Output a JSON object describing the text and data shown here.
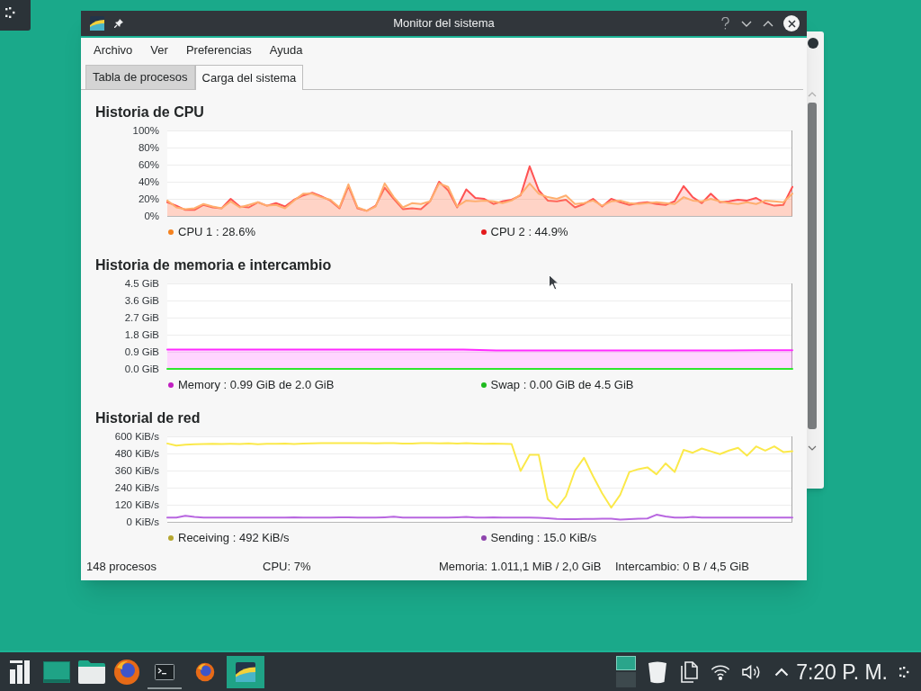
{
  "window": {
    "title": "Monitor del sistema"
  },
  "menu": [
    "Archivo",
    "Ver",
    "Preferencias",
    "Ayuda"
  ],
  "tabs": [
    {
      "label": "Tabla de procesos",
      "selected": false
    },
    {
      "label": "Carga del sistema",
      "selected": true
    }
  ],
  "sections": [
    {
      "title": "Historia de CPU",
      "chart_data": [
        {
          "type": "area",
          "ylim": [
            0,
            100
          ],
          "yticks": [
            {
              "value": 0,
              "label": "0%"
            },
            {
              "value": 20,
              "label": "20%"
            },
            {
              "value": 40,
              "label": "40%"
            },
            {
              "value": 60,
              "label": "60%"
            },
            {
              "value": 80,
              "label": "80%"
            },
            {
              "value": 100,
              "label": "100%"
            }
          ],
          "grid": true,
          "series": [
            {
              "color": "#ffae6e",
              "values": [
                18,
                10,
                8,
                9,
                14,
                11,
                9,
                17,
                10,
                13,
                16,
                12,
                13,
                9,
                18,
                26,
                26,
                22,
                19,
                10,
                37,
                10,
                6,
                11,
                38,
                22,
                10,
                15,
                14,
                17,
                38,
                34,
                11,
                18,
                17,
                18,
                17,
                15,
                18,
                25,
                38,
                26,
                22,
                20,
                24,
                14,
                15,
                18,
                12,
                17,
                18,
                15,
                14,
                15,
                16,
                15,
                14,
                22,
                18,
                17,
                20,
                17,
                15,
                14,
                16,
                14,
                18,
                17,
                16,
                26
              ]
            },
            {
              "color": "#ff5252",
              "values": [
                16,
                12,
                7,
                7,
                13,
                10,
                9,
                20,
                11,
                10,
                16,
                12,
                15,
                11,
                19,
                24,
                27,
                23,
                18,
                9,
                35,
                9,
                6,
                12,
                33,
                20,
                8,
                9,
                8,
                17,
                40,
                30,
                10,
                31,
                21,
                20,
                14,
                17,
                19,
                24,
                58,
                30,
                18,
                17,
                19,
                10,
                14,
                20,
                11,
                20,
                16,
                13,
                15,
                16,
                14,
                13,
                17,
                35,
                22,
                15,
                26,
                16,
                17,
                19,
                18,
                21,
                15,
                12,
                13,
                34
              ]
            }
          ]
        }
      ],
      "legend": [
        {
          "label": "CPU 1 : 28.6%",
          "color": "#f5821f"
        },
        {
          "label": "CPU 2 : 44.9%",
          "color": "#e31a1c"
        }
      ]
    },
    {
      "title": "Historia de memoria e intercambio",
      "chart_data": [
        {
          "type": "area",
          "ylim": [
            0,
            4.5
          ],
          "yticks": [
            {
              "value": 0,
              "label": "0.0 GiB"
            },
            {
              "value": 0.9,
              "label": "0.9 GiB"
            },
            {
              "value": 1.8,
              "label": "1.8 GiB"
            },
            {
              "value": 2.7,
              "label": "2.7 GiB"
            },
            {
              "value": 3.6,
              "label": "3.6 GiB"
            },
            {
              "value": 4.5,
              "label": "4.5 GiB"
            }
          ],
          "grid": true,
          "series": [
            {
              "color": "#ff2cff",
              "values": [
                1.02,
                1.02,
                1.02,
                1.02,
                1.02,
                1.02,
                1.02,
                1.02,
                1.02,
                1.02,
                0.97,
                0.97,
                0.97,
                0.97,
                0.97,
                0.97,
                0.97,
                0.97,
                0.98,
                0.98
              ]
            },
            {
              "type": "line",
              "color": "#2ee62e",
              "values": [
                0,
                0,
                0,
                0,
                0,
                0,
                0,
                0,
                0,
                0,
                0,
                0,
                0,
                0,
                0,
                0,
                0,
                0,
                0,
                0
              ]
            }
          ]
        }
      ],
      "legend": [
        {
          "label": "Memory : 0.99 GiB de 2.0 GiB",
          "color": "#c11fc1"
        },
        {
          "label": "Swap : 0.00 GiB de 4.5 GiB",
          "color": "#1fba1f"
        }
      ]
    },
    {
      "title": "Historial de red",
      "chart_data": [
        {
          "type": "line",
          "ylim": [
            0,
            600
          ],
          "yticks": [
            {
              "value": 0,
              "label": "0 KiB/s"
            },
            {
              "value": 120,
              "label": "120 KiB/s"
            },
            {
              "value": 240,
              "label": "240 KiB/s"
            },
            {
              "value": 360,
              "label": "360 KiB/s"
            },
            {
              "value": 480,
              "label": "480 KiB/s"
            },
            {
              "value": 600,
              "label": "600 KiB/s"
            }
          ],
          "grid": true,
          "series": [
            {
              "color": "#fbe94a",
              "values": [
                550,
                535,
                542,
                545,
                546,
                548,
                546,
                548,
                547,
                550,
                545,
                548,
                548,
                550,
                547,
                549,
                551,
                552,
                552,
                552,
                552,
                552,
                552,
                551,
                552,
                552,
                550,
                550,
                552,
                552,
                551,
                552,
                550,
                552,
                550,
                548,
                550,
                548,
                546,
                357,
                470,
                470,
                160,
                97,
                180,
                360,
                450,
                320,
                200,
                100,
                190,
                350,
                370,
                383,
                334,
                410,
                350,
                505,
                485,
                515,
                495,
                475,
                500,
                520,
                465,
                529,
                500,
                530,
                490,
                496
              ]
            },
            {
              "color": "#b866e0",
              "values": [
                30,
                30,
                42,
                34,
                30,
                30,
                30,
                30,
                30,
                30,
                30,
                30,
                30,
                30,
                31,
                30,
                30,
                30,
                30,
                32,
                32,
                30,
                30,
                30,
                32,
                36,
                30,
                30,
                30,
                30,
                30,
                30,
                32,
                34,
                30,
                30,
                32,
                30,
                30,
                30,
                30,
                28,
                26,
                20,
                18,
                18,
                20,
                20,
                22,
                22,
                16,
                18,
                22,
                24,
                50,
                38,
                30,
                30,
                34,
                30,
                30,
                30,
                30,
                30,
                30,
                30,
                30,
                30,
                30,
                30
              ]
            }
          ]
        }
      ],
      "legend": [
        {
          "label": "Receiving : 492 KiB/s",
          "color": "#b5a62f"
        },
        {
          "label": "Sending : 15.0 KiB/s",
          "color": "#8e44ad"
        }
      ]
    }
  ],
  "status_bar": [
    "148 procesos",
    "CPU: 7%",
    "Memoria: 1.011,1 MiB / 2,0 GiB",
    "Intercambio: 0 B / 4,5 GiB"
  ],
  "taskbar": {
    "launchers": [
      {
        "kind": "menu"
      },
      {
        "kind": "desktop"
      },
      {
        "kind": "folder"
      },
      {
        "kind": "browser"
      }
    ],
    "tasks": [
      {
        "kind": "terminal",
        "selected": false,
        "running": true
      },
      {
        "kind": "browser",
        "selected": false,
        "running": false
      },
      {
        "kind": "monitor",
        "selected": true,
        "running": false
      }
    ],
    "pager": [
      {
        "selected": true
      },
      {
        "selected": false
      }
    ],
    "tray": [
      {
        "kind": "trash"
      },
      {
        "kind": "document"
      },
      {
        "kind": "wifi"
      },
      {
        "kind": "volume"
      },
      {
        "kind": "expand"
      }
    ],
    "clock": "7:20 P. M."
  }
}
